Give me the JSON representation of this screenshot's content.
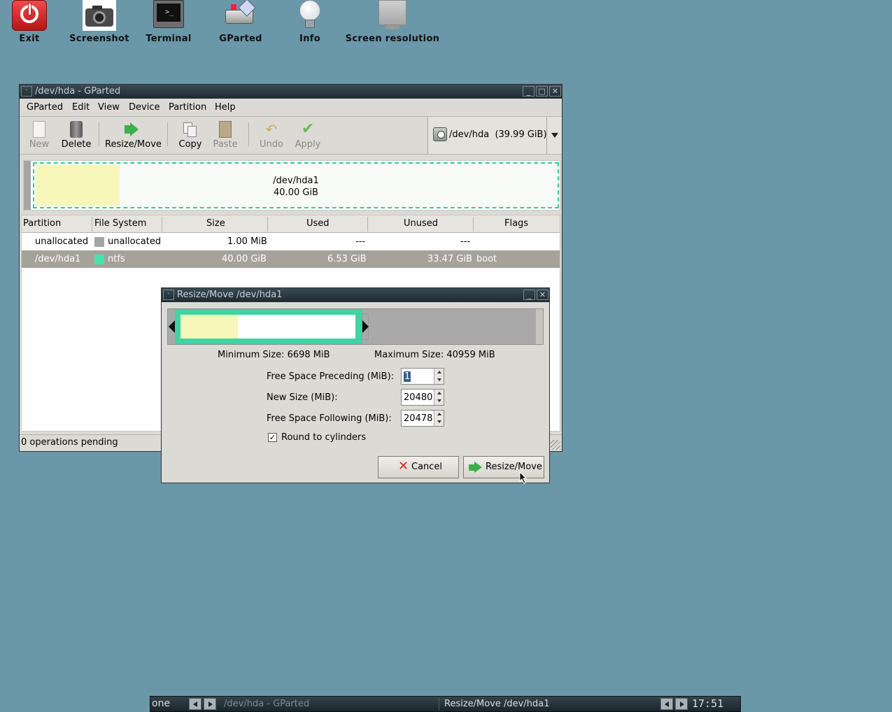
{
  "desktop": {
    "icons": [
      {
        "label": "Exit",
        "icon": "power-icon"
      },
      {
        "label": "Screenshot",
        "icon": "camera-icon"
      },
      {
        "label": "Terminal",
        "icon": "terminal-icon"
      },
      {
        "label": "GParted",
        "icon": "gparted-icon"
      },
      {
        "label": "Info",
        "icon": "lightbulb-icon"
      },
      {
        "label": "Screen resolution",
        "icon": "monitor-icon"
      }
    ]
  },
  "main_window": {
    "title": "/dev/hda - GParted",
    "menu": [
      "GParted",
      "Edit",
      "View",
      "Device",
      "Partition",
      "Help"
    ],
    "toolbar": {
      "new": "New",
      "delete": "Delete",
      "resize_move": "Resize/Move",
      "copy": "Copy",
      "paste": "Paste",
      "undo": "Undo",
      "apply": "Apply"
    },
    "device": {
      "name": "/dev/hda",
      "size": "(39.99 GiB)"
    },
    "disk_map": {
      "name": "/dev/hda1",
      "size": "40.00 GiB"
    },
    "columns": [
      "Partition",
      "File System",
      "Size",
      "Used",
      "Unused",
      "Flags"
    ],
    "rows": [
      {
        "partition": "unallocated",
        "fs": "unallocated",
        "fs_color": "#a5a5a5",
        "size": "1.00 MiB",
        "used": "---",
        "unused": "---",
        "flags": ""
      },
      {
        "partition": "/dev/hda1",
        "fs": "ntfs",
        "fs_color": "#42e5ac",
        "size": "40.00 GiB",
        "used": "6.53 GiB",
        "unused": "33.47 GiB",
        "flags": "boot"
      }
    ],
    "status": "0 operations pending"
  },
  "dialog": {
    "title": "Resize/Move /dev/hda1",
    "min_size": "Minimum Size: 6698 MiB",
    "max_size": "Maximum Size: 40959 MiB",
    "preceding_label": "Free Space Preceding (MiB):",
    "preceding_value": "1",
    "new_size_label": "New Size (MiB):",
    "new_size_value": "20480",
    "following_label": "Free Space Following (MiB):",
    "following_value": "20478",
    "round_label": "Round to cylinders",
    "round_checked": true,
    "cancel": "Cancel",
    "resize_move": "Resize/Move"
  },
  "taskbar": {
    "workspace": "one",
    "task1": "/dev/hda - GParted",
    "task2": "Resize/Move /dev/hda1",
    "clock": "17:51"
  },
  "colors": {
    "desktop": "#6a98a8",
    "ntfs": "#42e5ac",
    "used": "#f6f7b8",
    "unallocated": "#a5a5a5"
  }
}
